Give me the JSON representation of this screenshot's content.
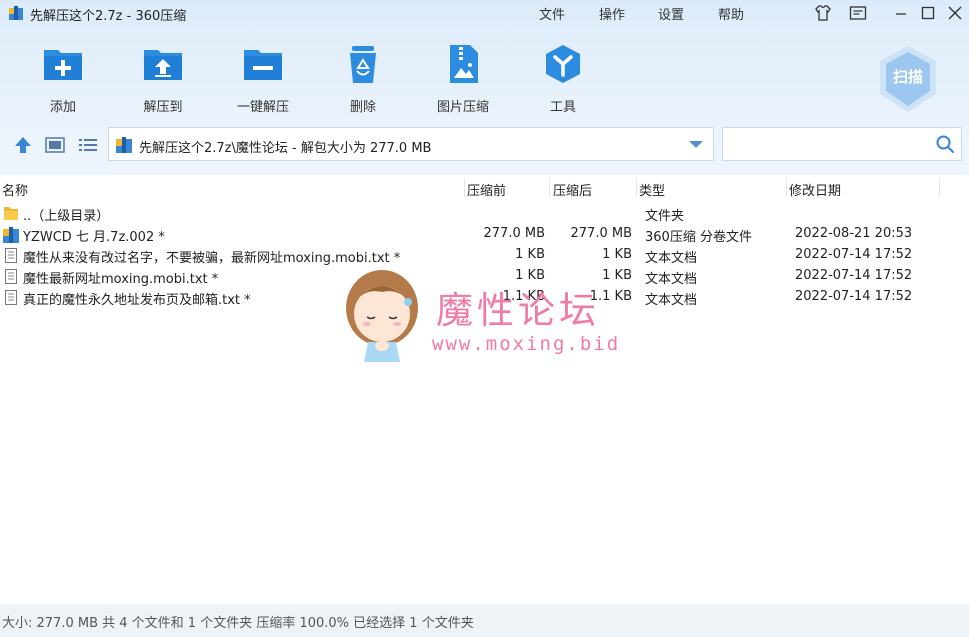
{
  "window": {
    "title": "先解压这个2.7z - 360压缩"
  },
  "menu": [
    "文件",
    "操作",
    "设置",
    "帮助"
  ],
  "toolbar": {
    "buttons": [
      {
        "label": "添加",
        "icon": "add-icon"
      },
      {
        "label": "解压到",
        "icon": "extract-to-icon"
      },
      {
        "label": "一键解压",
        "icon": "one-click-extract-icon"
      },
      {
        "label": "删除",
        "icon": "delete-icon"
      },
      {
        "label": "图片压缩",
        "icon": "image-compress-icon"
      },
      {
        "label": "工具",
        "icon": "tools-icon"
      }
    ],
    "scan_label": "扫描"
  },
  "address": {
    "path": "先解压这个2.7z\\魔性论坛 - 解包大小为 277.0 MB"
  },
  "search": {
    "placeholder": ""
  },
  "columns": [
    "名称",
    "压缩前",
    "压缩后",
    "类型",
    "修改日期"
  ],
  "files": [
    {
      "name": "..（上级目录）",
      "before": "",
      "after": "",
      "type": "文件夹",
      "date": "",
      "icon": "folder-icon"
    },
    {
      "name": "YZWCD 七 月.7z.002 *",
      "before": "277.0 MB",
      "after": "277.0 MB",
      "type": "360压缩 分卷文件",
      "date": "2022-08-21 20:53",
      "icon": "archive-icon"
    },
    {
      "name": "魔性从来没有改过名字，不要被骗，最新网址moxing.mobi.txt *",
      "before": "1 KB",
      "after": "1 KB",
      "type": "文本文档",
      "date": "2022-07-14 17:52",
      "icon": "text-file-icon"
    },
    {
      "name": "魔性最新网址moxing.mobi.txt *",
      "before": "1 KB",
      "after": "1 KB",
      "type": "文本文档",
      "date": "2022-07-14 17:52",
      "icon": "text-file-icon"
    },
    {
      "name": "真正的魔性永久地址发布页及邮箱.txt *",
      "before": "1.1 KB",
      "after": "1.1 KB",
      "type": "文本文档",
      "date": "2022-07-14 17:52",
      "icon": "text-file-icon"
    }
  ],
  "watermark": {
    "title": "魔性论坛",
    "url": "www.moxing.bid"
  },
  "status": "大小: 277.0 MB 共 4 个文件和 1 个文件夹 压缩率 100.0% 已经选择 1 个文件夹",
  "colors": {
    "accent": "#2b8ce0",
    "toolbar_bg": "#e4effa",
    "watermark": "#f07aa8"
  }
}
